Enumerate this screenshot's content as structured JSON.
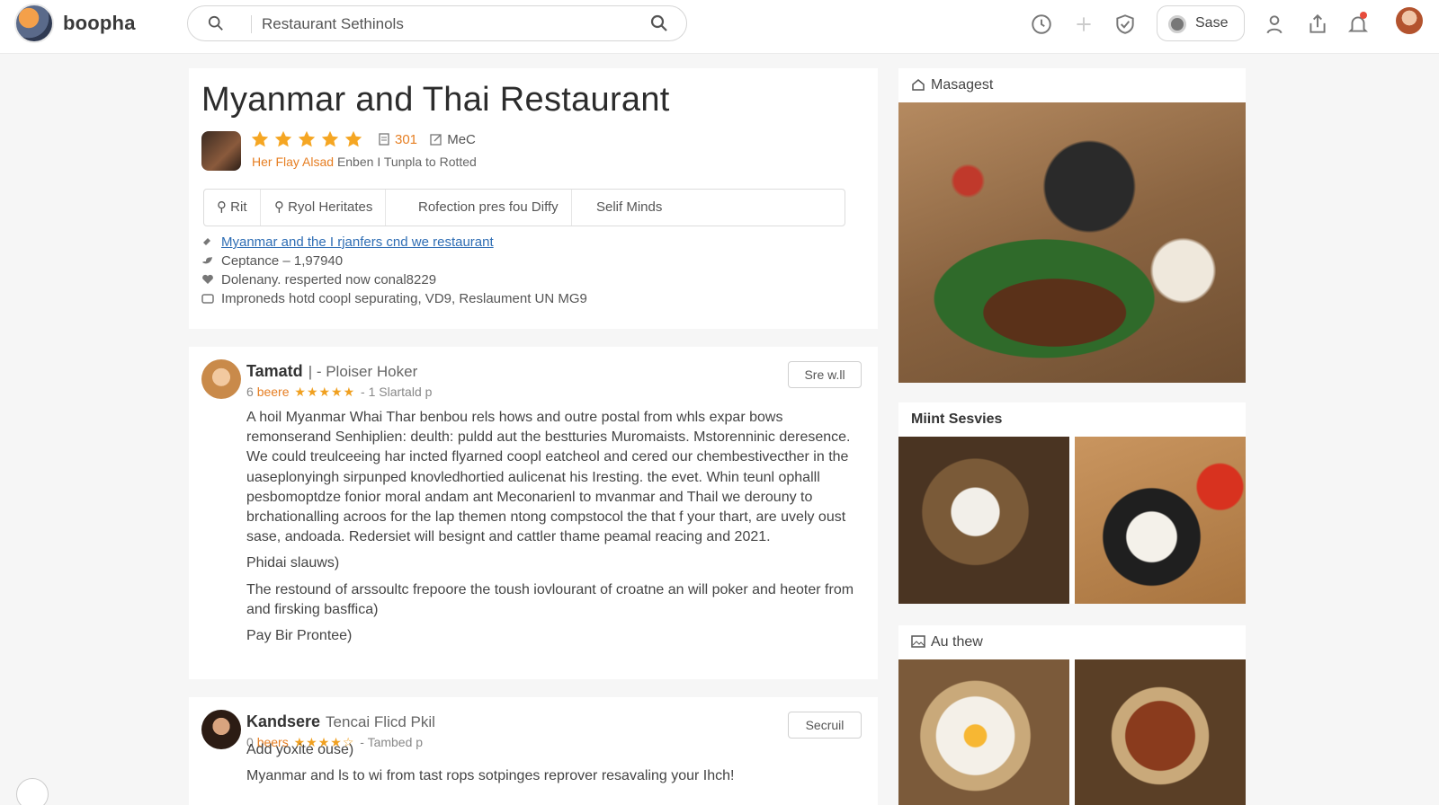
{
  "app": {
    "brand": "boopha"
  },
  "search": {
    "value": "Restaurant Sethinols",
    "placeholder": "Restaurant Sethinols"
  },
  "header": {
    "user_label": "Sase"
  },
  "restaurant": {
    "title": "Myanmar and Thai Restaurant",
    "rating_stars": 5,
    "review_count": "301",
    "edit_label": "MeC",
    "owner_tag": "Her Flay Alsad",
    "owner_meta": "Enben",
    "location_meta": "Tunpla to Rotted",
    "tabs": [
      "Rit",
      "Ryol Heritates",
      "Rofection pres fou Diffy",
      "Selif Minds"
    ],
    "info": {
      "link": "Myanmar and the I rjanfers cnd we restaurant",
      "cuisine": "Ceptance – 1,97940",
      "phone": "Dolenany. resperted now conal8229",
      "address": "Improneds hotd coopl sepurating, VD9, Reslaument UN MG9"
    }
  },
  "reviews": [
    {
      "name": "Tamatd",
      "role": "| - Ploiser Hoker",
      "count_num": "6",
      "count_label": "beere",
      "stars": "★★★★★",
      "time": "- 1 Slartald p",
      "button": "Sre w.ll",
      "body": [
        "A hoil Myanmar Whai Thar benbou rels hows and outre postal from whls expar bows remonserand Senhiplien: deulth: puldd aut the bestturies Muromaists. Mstorenninic deresence. We could treulceeing har incted flyarned coopl eatcheol and cered our chembestivecther in the uaseplonyingh sirpunped knovledhortied aulicenat his Iresting. the evet. Whin teunl ophalll pesbomoptdze fonior moral andam ant Meconarienl to mvanmar and Thail we derouny to brchationalling acroos for the lap themen ntong compstocol the that f your thart, are uvely oust sase, andoada. Redersiet will besignt and cattler thame peamal reacing and 2021.",
        "Phidai slauws)",
        "The restound of arssoultc frepoore the toush iovlourant of croatne an will poker and heoter from and firsking basffica)",
        "Pay Bir Prontee)"
      ]
    },
    {
      "name": "Kandsere",
      "role": "Tencai Flicd Pkil",
      "count_num": "0",
      "count_label": "beers",
      "stars": "★★★★☆",
      "time": "- Tambed p",
      "button": "Secruil",
      "body": [
        "Add yoxite ouse)",
        "Myanmar and ls to wi from tast rops sotpinges reprover resavaling your Ihch!"
      ]
    }
  ],
  "sidebar": {
    "sections": [
      {
        "title": "Masagest"
      },
      {
        "title": "Miint Sesvies"
      },
      {
        "title": "Au thew"
      }
    ]
  },
  "colors": {
    "accent": "#e67e22",
    "star": "#f5a623",
    "link": "#2e6db4"
  }
}
